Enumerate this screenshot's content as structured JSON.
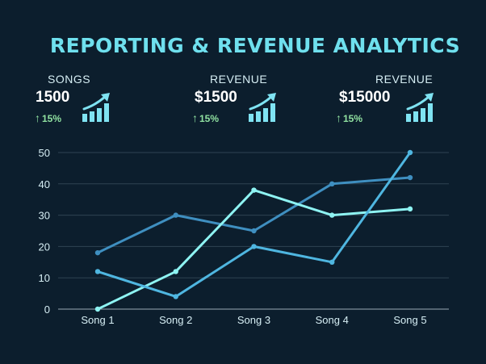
{
  "title": "REPORTING & REVENUE ANALYTICS",
  "kpis": [
    {
      "label": "SONGS",
      "value": "1500",
      "change": "15%"
    },
    {
      "label": "REVENUE",
      "value": "$1500",
      "change": "15%"
    },
    {
      "label": "REVENUE",
      "value": "$15000",
      "change": "15%"
    }
  ],
  "icons": {
    "kpi": "bar-chart-growth-icon",
    "change": "arrow-up-icon"
  },
  "colors": {
    "background": "#0c1e2d",
    "title": "#6fe0ee",
    "change": "#8fe0a0",
    "icon": "#7fe3f2"
  },
  "chart_data": {
    "type": "line",
    "categories": [
      "Song 1",
      "Song 2",
      "Song 3",
      "Song 4",
      "Song 5"
    ],
    "ylim": [
      0,
      50
    ],
    "yticks": [
      0,
      10,
      20,
      30,
      40,
      50
    ],
    "grid": true,
    "series": [
      {
        "values": [
          18,
          30,
          25,
          40,
          42
        ],
        "color": "#3f8fc0"
      },
      {
        "values": [
          0,
          12,
          38,
          30,
          32
        ],
        "color": "#8ef3f2"
      },
      {
        "values": [
          12,
          4,
          20,
          15,
          50
        ],
        "color": "#4fb6e0"
      }
    ]
  }
}
